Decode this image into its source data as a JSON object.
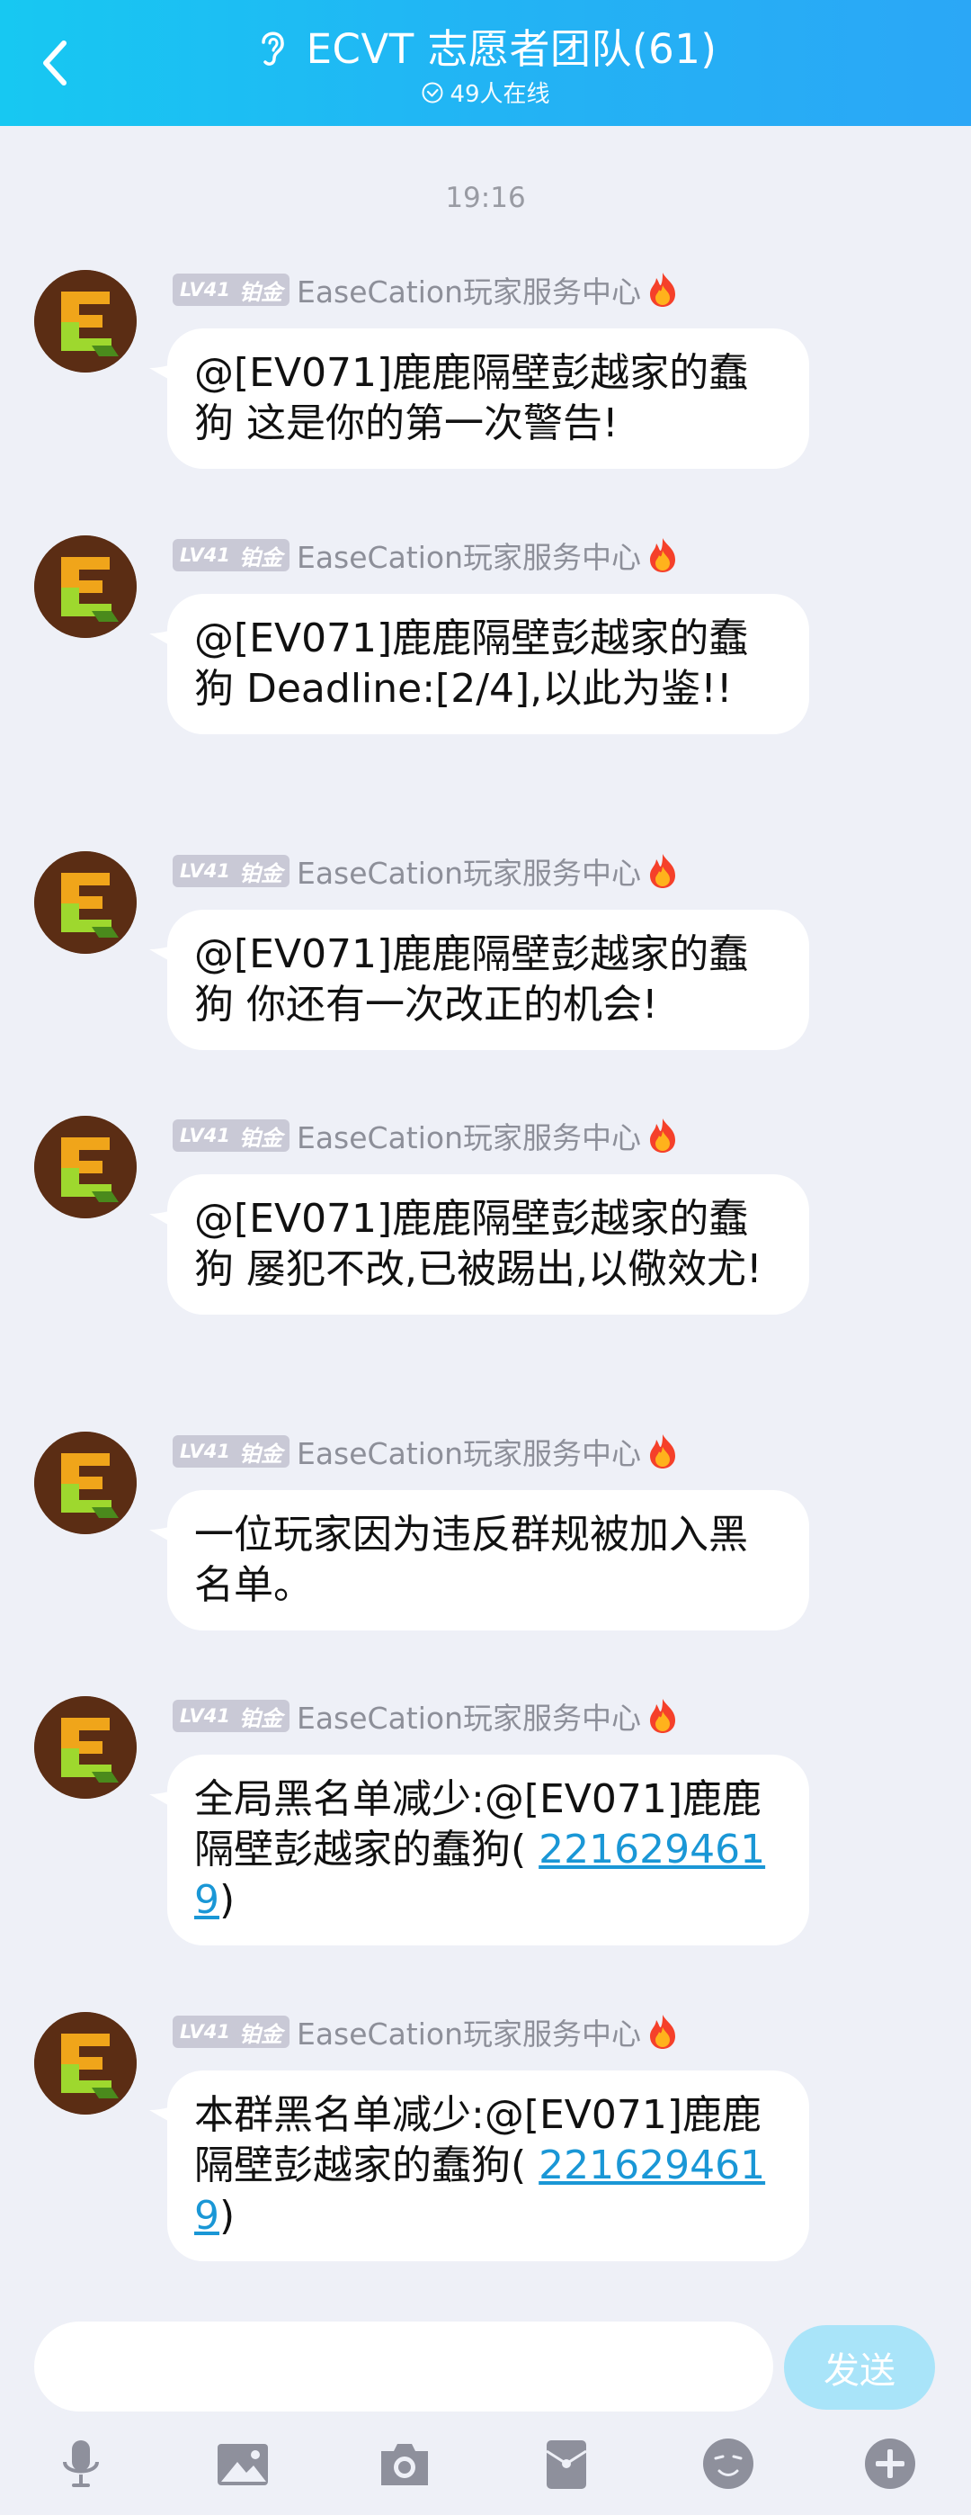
{
  "header": {
    "title": "ECVT 志愿者团队(61)",
    "online": "49人在线",
    "back_icon": "chevron-left-icon",
    "title_icon": "ear-icon"
  },
  "timestamp": "19:16",
  "sender": {
    "level": "LV41",
    "rank": "铂金",
    "name": "EaseCation玩家服务中心",
    "badge_icon": "fire-icon"
  },
  "messages": [
    {
      "text": "@[EV071]鹿鹿隔壁彭越家的蠢狗  这是你的第一次警告!"
    },
    {
      "text": "@[EV071]鹿鹿隔壁彭越家的蠢狗  Deadline:[2/4],以此为鉴!!"
    },
    {
      "text": "@[EV071]鹿鹿隔壁彭越家的蠢狗  你还有一次改正的机会!"
    },
    {
      "text": "@[EV071]鹿鹿隔壁彭越家的蠢狗  屡犯不改,已被踢出,以儆效尤!"
    },
    {
      "text": "一位玩家因为违反群规被加入黑名单。"
    },
    {
      "text": "全局黑名单减少:@[EV071]鹿鹿隔壁彭越家的蠢狗(",
      "link": "2216294619",
      "suffix": ")"
    },
    {
      "text": "本群黑名单减少:@[EV071]鹿鹿隔壁彭越家的蠢狗(",
      "link": "2216294619",
      "suffix": ")"
    }
  ],
  "input": {
    "placeholder": "",
    "value": "",
    "send_label": "发送"
  },
  "toolbar": [
    "mic-icon",
    "image-icon",
    "camera-icon",
    "red-packet-icon",
    "emoji-icon",
    "plus-icon"
  ],
  "colors": {
    "header_start": "#17c8f2",
    "header_end": "#2ba7f6",
    "link": "#1a97d6",
    "send_disabled": "#a9e4f9"
  }
}
